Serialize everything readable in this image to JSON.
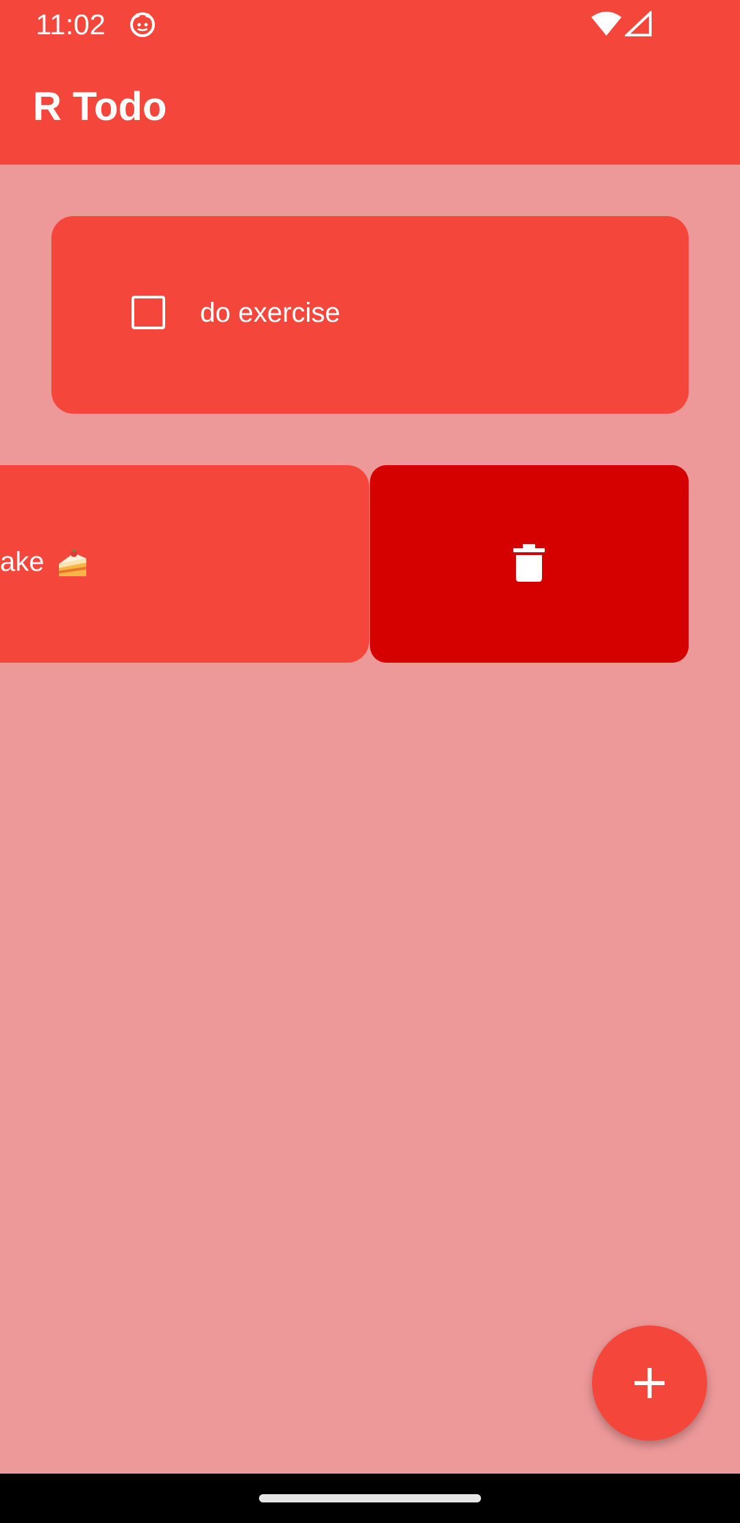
{
  "status_bar": {
    "time": "11:02",
    "app_icon": "cat-face-icon",
    "wifi_icon": "wifi-icon",
    "signal_icon": "cell-signal-icon"
  },
  "app_bar": {
    "title": "R Todo"
  },
  "todos": [
    {
      "text": "do exercise",
      "checked": false
    },
    {
      "text": "ake",
      "icon": "cake-icon",
      "swiped": true
    }
  ],
  "delete_action": {
    "icon": "trash-icon"
  },
  "fab": {
    "icon": "plus-icon"
  },
  "colors": {
    "primary": "#f5463b",
    "background": "#ee9999",
    "delete": "#d50000",
    "on_primary": "#ffffff"
  }
}
